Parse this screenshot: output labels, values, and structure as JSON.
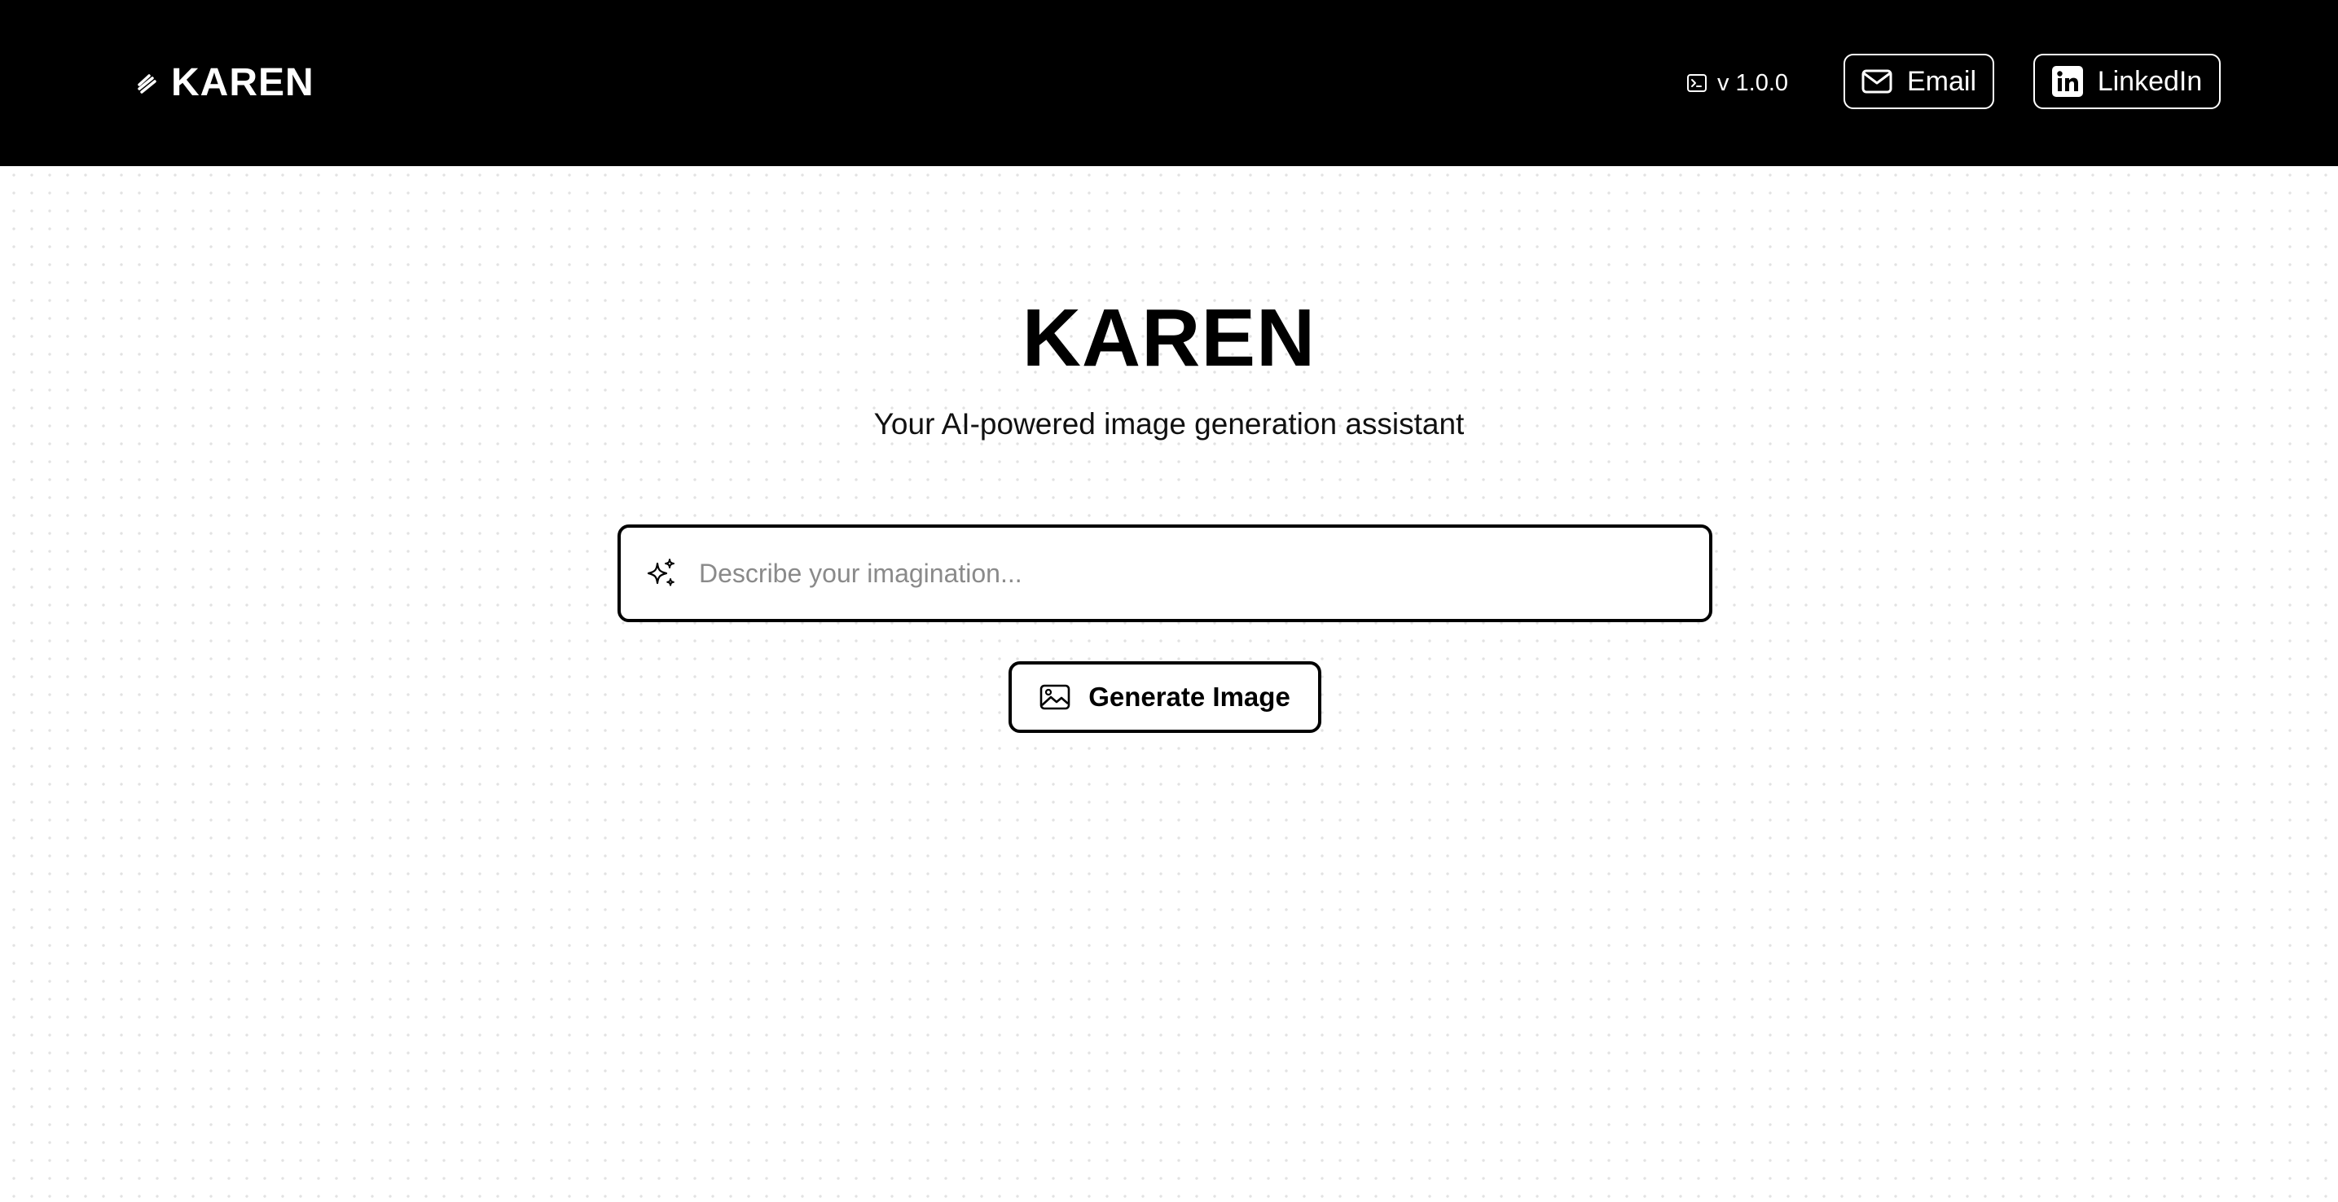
{
  "header": {
    "brand_name": "KAREN",
    "brand_icon": "slash-lines-icon",
    "version": "v 1.0.0",
    "version_icon": "terminal-icon",
    "email_label": "Email",
    "email_icon": "mail-icon",
    "linkedin_label": "LinkedIn",
    "linkedin_icon": "linkedin-icon"
  },
  "hero": {
    "title": "KAREN",
    "subtitle": "Your AI-powered image generation assistant"
  },
  "prompt": {
    "icon": "sparkles-icon",
    "placeholder": "Describe your imagination...",
    "value": ""
  },
  "generate": {
    "icon": "image-icon",
    "label": "Generate Image"
  },
  "colors": {
    "header_bg": "#000000",
    "header_text": "#ffffff",
    "page_bg": "#ffffff",
    "dot_grid": "#e2e2e2",
    "accent": "#000000"
  }
}
